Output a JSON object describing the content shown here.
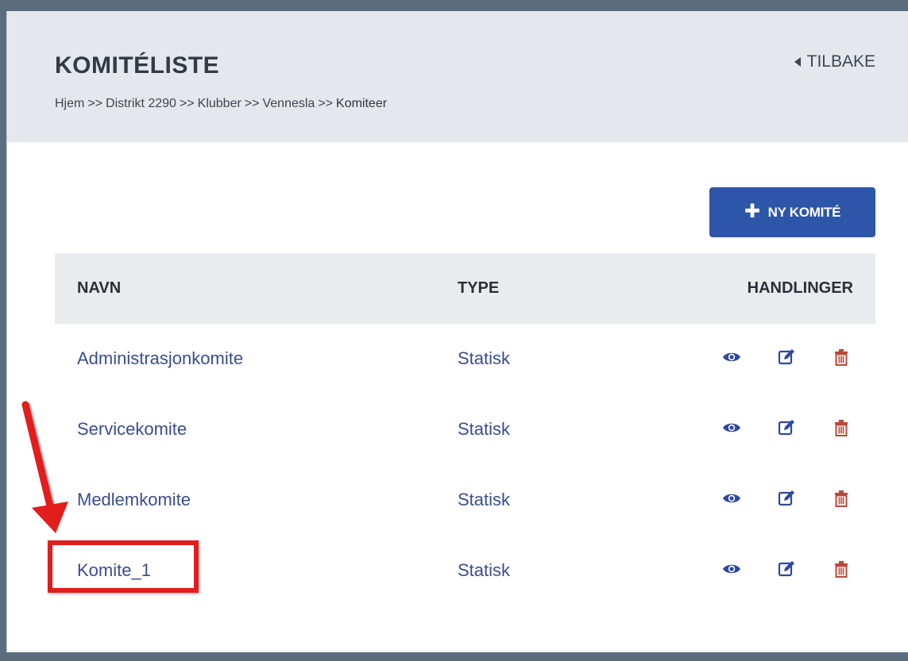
{
  "header": {
    "title": "KOMITÉLISTE",
    "back_label": "TILBAKE",
    "breadcrumb": [
      {
        "label": "Hjem",
        "sep": ">>"
      },
      {
        "label": "Distrikt 2290",
        "sep": ">>"
      },
      {
        "label": "Klubber",
        "sep": ">>"
      },
      {
        "label": "Vennesla",
        "sep": ">>"
      },
      {
        "label": "Komiteer",
        "sep": ""
      }
    ]
  },
  "toolbar": {
    "new_button_label": "NY KOMITÉ"
  },
  "table": {
    "columns": [
      "NAVN",
      "TYPE",
      "HANDLINGER"
    ],
    "rows": [
      {
        "name": "Administrasjonkomite",
        "type": "Statisk"
      },
      {
        "name": "Servicekomite",
        "type": "Statisk"
      },
      {
        "name": "Medlemkomite",
        "type": "Statisk"
      },
      {
        "name": "Komite_1",
        "type": "Statisk"
      }
    ],
    "row_actions": [
      "eye-icon",
      "edit-icon",
      "trash-icon"
    ]
  },
  "annotation": {
    "highlighted_row": "Komite_1",
    "color": "#e31c1c"
  },
  "colors": {
    "primary_button": "#2d55a8",
    "link": "#3a4d8f",
    "delete": "#b84a3a",
    "header_bg": "#e4e7ec"
  }
}
